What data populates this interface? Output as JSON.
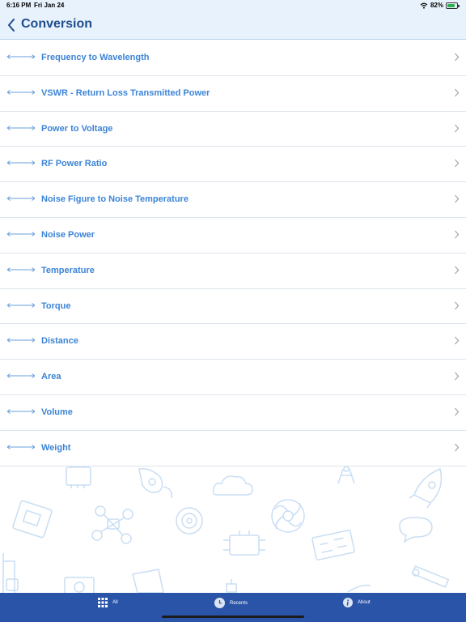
{
  "status": {
    "time": "6:16 PM",
    "date": "Fri Jan 24",
    "battery": "82%",
    "battery_level": 0.82
  },
  "nav": {
    "title": "Conversion"
  },
  "list": {
    "items": [
      {
        "label": "Frequency to Wavelength"
      },
      {
        "label": "VSWR - Return Loss Transmitted Power"
      },
      {
        "label": "Power to Voltage"
      },
      {
        "label": "RF Power Ratio"
      },
      {
        "label": "Noise Figure to Noise Temperature"
      },
      {
        "label": "Noise Power"
      },
      {
        "label": "Temperature"
      },
      {
        "label": "Torque"
      },
      {
        "label": "Distance"
      },
      {
        "label": "Area"
      },
      {
        "label": "Volume"
      },
      {
        "label": "Weight"
      }
    ]
  },
  "tabbar": {
    "tabs": [
      {
        "label": "All",
        "icon": "grid-icon"
      },
      {
        "label": "Recents",
        "icon": "clock-icon"
      },
      {
        "label": "About",
        "icon": "info-icon"
      }
    ]
  },
  "colors": {
    "accent": "#3d84d6",
    "title": "#1f4d8e",
    "tabbar": "#2a54a8",
    "nav_bg": "#e8f2fc"
  }
}
